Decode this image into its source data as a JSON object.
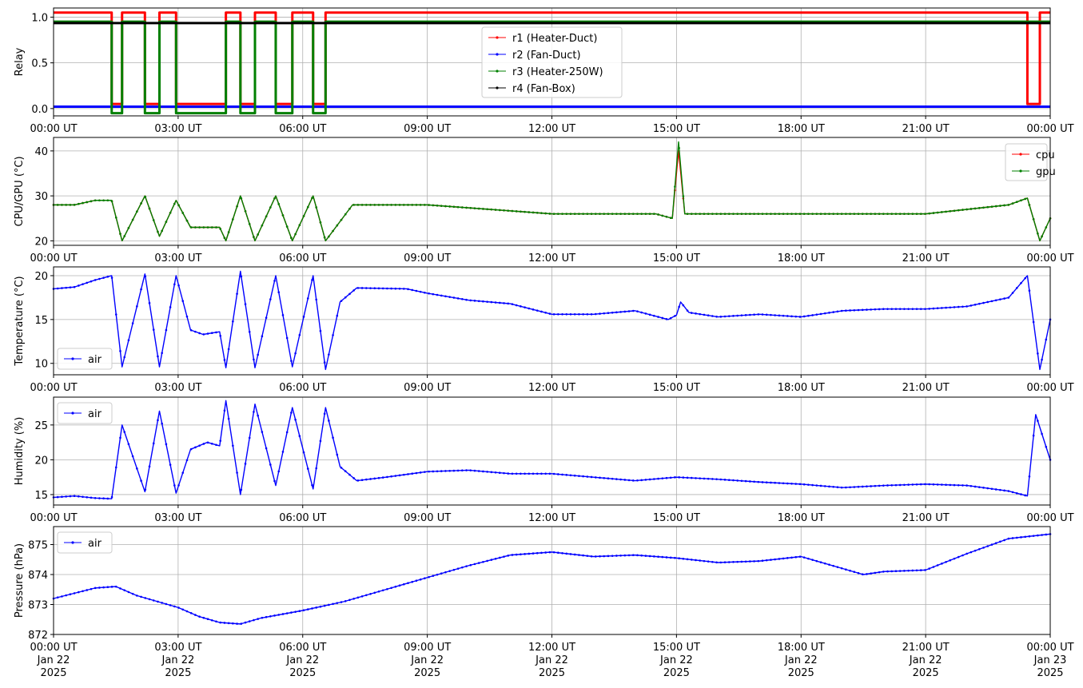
{
  "chart_data": [
    {
      "type": "line",
      "ylabel": "Relay",
      "xlabel": "",
      "xlim": [
        "00:00 UT",
        "24:00 UT"
      ],
      "ylim": [
        -0.08,
        1.1
      ],
      "yticks": [
        0.0,
        0.5,
        1.0
      ],
      "ytick_labels": [
        "0.0",
        "0.5",
        "1.0"
      ],
      "xtick_labels": [
        "00:00 UT",
        "03:00 UT",
        "06:00 UT",
        "09:00 UT",
        "12:00 UT",
        "15:00 UT",
        "18:00 UT",
        "21:00 UT",
        "00:00 UT"
      ],
      "grid": true,
      "legend_position": "upper-center",
      "marker_size": 1.6,
      "series": [
        {
          "name": "r1 (Heater-Duct)",
          "color": "#ff0000",
          "offset": 0.05,
          "x": [
            0,
            1.4,
            1.4,
            1.65,
            1.65,
            2.2,
            2.2,
            2.55,
            2.55,
            2.95,
            2.95,
            4.15,
            4.15,
            4.5,
            4.5,
            4.85,
            4.85,
            5.35,
            5.35,
            5.75,
            5.75,
            6.25,
            6.25,
            6.55,
            6.55,
            23.45,
            23.45,
            23.75,
            23.75,
            24
          ],
          "y": [
            1,
            1,
            0,
            0,
            1,
            1,
            0,
            0,
            1,
            1,
            0,
            0,
            1,
            1,
            0,
            0,
            1,
            1,
            0,
            0,
            1,
            1,
            0,
            0,
            1,
            1,
            0,
            0,
            1,
            1
          ]
        },
        {
          "name": "r2 (Fan-Duct)",
          "color": "#0000ff",
          "offset": 0.02,
          "x": [
            0,
            24
          ],
          "y": [
            0,
            0
          ]
        },
        {
          "name": "r3 (Heater-250W)",
          "color": "#008000",
          "offset": -0.05,
          "x": [
            0,
            1.4,
            1.4,
            1.65,
            1.65,
            2.2,
            2.2,
            2.55,
            2.55,
            2.95,
            2.95,
            4.15,
            4.15,
            4.5,
            4.5,
            4.85,
            4.85,
            5.35,
            5.35,
            5.75,
            5.75,
            6.25,
            6.25,
            6.55,
            6.55,
            24
          ],
          "y": [
            1,
            1,
            0,
            0,
            1,
            1,
            0,
            0,
            1,
            1,
            0,
            0,
            1,
            1,
            0,
            0,
            1,
            1,
            0,
            0,
            1,
            1,
            0,
            0,
            1,
            1
          ]
        },
        {
          "name": "r4 (Fan-Box)",
          "color": "#000000",
          "offset": -0.065,
          "x": [
            0,
            24
          ],
          "y": [
            1,
            1
          ]
        }
      ]
    },
    {
      "type": "line",
      "ylabel": "CPU/GPU (°C)",
      "xlabel": "",
      "xlim": [
        "00:00 UT",
        "24:00 UT"
      ],
      "ylim": [
        19,
        43
      ],
      "yticks": [
        20,
        30,
        40
      ],
      "ytick_labels": [
        "20",
        "30",
        "40"
      ],
      "xtick_labels": [
        "00:00 UT",
        "03:00 UT",
        "06:00 UT",
        "09:00 UT",
        "12:00 UT",
        "15:00 UT",
        "18:00 UT",
        "21:00 UT",
        "00:00 UT"
      ],
      "grid": true,
      "legend_position": "upper-right",
      "series": [
        {
          "name": "cpu",
          "color": "#ff0000",
          "x": [
            0,
            0.5,
            1.0,
            1.4,
            1.65,
            2.2,
            2.55,
            2.95,
            3.3,
            4.0,
            4.15,
            4.5,
            4.85,
            5.35,
            5.75,
            6.25,
            6.55,
            7.2,
            9.0,
            10.5,
            12.0,
            14.5,
            14.9,
            15.05,
            15.2,
            15.5,
            17.0,
            21.0,
            23.0,
            23.45,
            23.75,
            24.0
          ],
          "y": [
            28,
            28,
            29,
            29,
            20,
            30,
            21,
            29,
            23,
            23,
            20,
            30,
            20,
            30,
            20,
            30,
            20,
            28,
            28,
            27,
            26,
            26,
            25,
            40,
            26,
            26,
            26,
            26,
            28,
            29.5,
            20,
            25
          ]
        },
        {
          "name": "gpu",
          "color": "#008000",
          "x": [
            0,
            0.5,
            1.0,
            1.4,
            1.65,
            2.2,
            2.55,
            2.95,
            3.3,
            4.0,
            4.15,
            4.5,
            4.85,
            5.35,
            5.75,
            6.25,
            6.55,
            7.2,
            9.0,
            10.5,
            12.0,
            14.5,
            14.9,
            15.05,
            15.2,
            15.5,
            17.0,
            21.0,
            23.0,
            23.45,
            23.75,
            24.0
          ],
          "y": [
            28,
            28,
            29,
            29,
            20,
            30,
            21,
            29,
            23,
            23,
            20,
            30,
            20,
            30,
            20,
            30,
            20,
            28,
            28,
            27,
            26,
            26,
            25,
            42,
            26,
            26,
            26,
            26,
            28,
            29.5,
            20,
            25
          ]
        }
      ]
    },
    {
      "type": "line",
      "ylabel": "Temperature (°C)",
      "xlabel": "",
      "xlim": [
        "00:00 UT",
        "24:00 UT"
      ],
      "ylim": [
        8.7,
        21
      ],
      "yticks": [
        10,
        15,
        20
      ],
      "ytick_labels": [
        "10",
        "15",
        "20"
      ],
      "xtick_labels": [
        "00:00 UT",
        "03:00 UT",
        "06:00 UT",
        "09:00 UT",
        "12:00 UT",
        "15:00 UT",
        "18:00 UT",
        "21:00 UT",
        "00:00 UT"
      ],
      "grid": true,
      "legend_position": "lower-left",
      "series": [
        {
          "name": "air",
          "color": "#0000ff",
          "x": [
            0,
            0.5,
            1.0,
            1.4,
            1.65,
            2.2,
            2.55,
            2.95,
            3.3,
            3.6,
            4.0,
            4.15,
            4.5,
            4.85,
            5.35,
            5.75,
            6.25,
            6.55,
            6.9,
            7.3,
            8.5,
            9.0,
            10.0,
            11.0,
            12.0,
            13.0,
            14.0,
            14.8,
            15.0,
            15.1,
            15.3,
            16.0,
            17.0,
            18.0,
            19.0,
            20.0,
            21.0,
            22.0,
            23.0,
            23.45,
            23.75,
            24.0
          ],
          "y": [
            18.5,
            18.7,
            19.5,
            20.0,
            9.6,
            20.2,
            9.6,
            20.0,
            13.8,
            13.3,
            13.6,
            9.5,
            20.5,
            9.5,
            20.0,
            9.6,
            20.0,
            9.3,
            17.0,
            18.6,
            18.5,
            18.0,
            17.2,
            16.8,
            15.6,
            15.6,
            16.0,
            15.0,
            15.5,
            17.0,
            15.8,
            15.3,
            15.6,
            15.3,
            16.0,
            16.2,
            16.2,
            16.5,
            17.5,
            20.0,
            9.3,
            15.0
          ]
        }
      ]
    },
    {
      "type": "line",
      "ylabel": "Humidity (%)",
      "xlabel": "",
      "xlim": [
        "00:00 UT",
        "24:00 UT"
      ],
      "ylim": [
        13.5,
        29
      ],
      "yticks": [
        15,
        20,
        25
      ],
      "ytick_labels": [
        "15",
        "20",
        "25"
      ],
      "xtick_labels": [
        "00:00 UT",
        "03:00 UT",
        "06:00 UT",
        "09:00 UT",
        "12:00 UT",
        "15:00 UT",
        "18:00 UT",
        "21:00 UT",
        "00:00 UT"
      ],
      "grid": true,
      "legend_position": "upper-left",
      "series": [
        {
          "name": "air",
          "color": "#0000ff",
          "x": [
            0,
            0.5,
            1.0,
            1.4,
            1.65,
            2.2,
            2.55,
            2.95,
            3.3,
            3.7,
            4.0,
            4.15,
            4.5,
            4.85,
            5.35,
            5.75,
            6.25,
            6.55,
            6.9,
            7.3,
            8.0,
            9.0,
            10.0,
            11.0,
            12.0,
            13.0,
            14.0,
            15.0,
            16.0,
            17.0,
            18.0,
            19.0,
            20.0,
            21.0,
            22.0,
            23.0,
            23.45,
            23.65,
            24.0
          ],
          "y": [
            14.6,
            14.8,
            14.5,
            14.4,
            25.0,
            15.4,
            27.0,
            15.2,
            21.5,
            22.5,
            22.0,
            28.5,
            15.0,
            28.0,
            16.3,
            27.5,
            15.8,
            27.5,
            19.0,
            17.0,
            17.5,
            18.3,
            18.5,
            18.0,
            18.0,
            17.5,
            17.0,
            17.5,
            17.2,
            16.8,
            16.5,
            16.0,
            16.3,
            16.5,
            16.3,
            15.5,
            14.8,
            26.5,
            20.0
          ]
        }
      ]
    },
    {
      "type": "line",
      "ylabel": "Pressure (hPa)",
      "xlabel": "",
      "xlim": [
        "00:00 UT",
        "24:00 UT"
      ],
      "ylim": [
        872.0,
        875.6
      ],
      "yticks": [
        872,
        873,
        874,
        875
      ],
      "ytick_labels": [
        "872",
        "873",
        "874",
        "875"
      ],
      "xtick_labels": [
        "00:00 UT\nJan 22\n2025",
        "03:00 UT\nJan 22\n2025",
        "06:00 UT\nJan 22\n2025",
        "09:00 UT\nJan 22\n2025",
        "12:00 UT\nJan 22\n2025",
        "15:00 UT\nJan 22\n2025",
        "18:00 UT\nJan 22\n2025",
        "21:00 UT\nJan 22\n2025",
        "00:00 UT\nJan 23\n2025"
      ],
      "grid": true,
      "legend_position": "upper-left",
      "series": [
        {
          "name": "air",
          "color": "#0000ff",
          "x": [
            0,
            1.0,
            1.5,
            2.0,
            3.0,
            3.5,
            4.0,
            4.5,
            5.0,
            6.0,
            7.0,
            8.0,
            9.0,
            10.0,
            11.0,
            12.0,
            13.0,
            14.0,
            15.0,
            16.0,
            17.0,
            18.0,
            19.0,
            19.5,
            20.0,
            21.0,
            22.0,
            23.0,
            24.0
          ],
          "y": [
            873.2,
            873.55,
            873.6,
            873.3,
            872.9,
            872.6,
            872.4,
            872.35,
            872.55,
            872.8,
            873.1,
            873.5,
            873.9,
            874.3,
            874.65,
            874.75,
            874.6,
            874.65,
            874.55,
            874.4,
            874.45,
            874.6,
            874.2,
            874.0,
            874.1,
            874.15,
            874.7,
            875.2,
            875.35
          ]
        }
      ]
    }
  ]
}
